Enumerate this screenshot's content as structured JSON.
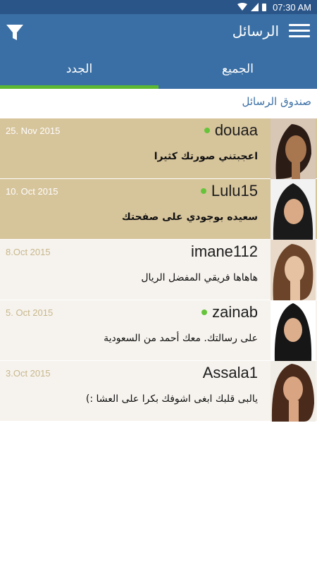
{
  "status_bar": {
    "time": "07:30 AM",
    "icons": [
      "wifi-icon",
      "cellular-icon",
      "battery-icon"
    ]
  },
  "app_bar": {
    "title": "الرسائل",
    "left_icon": "filter-icon",
    "right_icon": "menu-icon"
  },
  "tabs": [
    {
      "label": "الجدد",
      "active": true
    },
    {
      "label": "الجميع",
      "active": false
    }
  ],
  "section_title": "صندوق الرسائل",
  "messages": [
    {
      "name": "douaa",
      "date": "25. Nov 2015",
      "text": "اعجبتني صورتك كثيرا",
      "online": true,
      "unread": true,
      "avatar": "avatar-photo"
    },
    {
      "name": "Lulu15",
      "date": "10. Oct 2015",
      "text": "سعيده بوجودي على صفحتك",
      "online": true,
      "unread": true,
      "avatar": "avatar-photo"
    },
    {
      "name": "imane112",
      "date": "8.Oct 2015",
      "text": "هاهاها فريقي المفضل الريال",
      "online": false,
      "unread": false,
      "avatar": "avatar-photo"
    },
    {
      "name": "zainab",
      "date": "5. Oct 2015",
      "text": "على رسالتك. معك أحمد من السعودية",
      "online": true,
      "unread": false,
      "avatar": "avatar-photo"
    },
    {
      "name": "Assala1",
      "date": "3.Oct 2015",
      "text": "يالبى قلبك ابغى اشوفك بكرا على العشا :)",
      "online": false,
      "unread": false,
      "avatar": "avatar-photo"
    }
  ],
  "colors": {
    "status_bar": "#2a5588",
    "app_bar": "#3a6fa5",
    "tab_indicator": "#5cb832",
    "unread_row": "#d6c49b",
    "read_row": "#f6f3ee",
    "online_dot": "#66c43b",
    "section_title": "#3a6fa5"
  }
}
